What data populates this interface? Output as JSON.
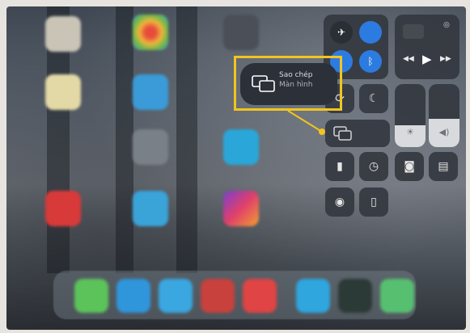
{
  "callout": {
    "title": "Sao chép",
    "subtitle": "Màn hình",
    "frame_color": "#f2c51e",
    "dot_color": "#f2c51e"
  },
  "mirror_tile": {
    "label": ""
  },
  "control_center": {
    "connectivity": [
      "airplane-icon",
      "cellular-icon",
      "wifi-icon",
      "bluetooth-icon"
    ],
    "media": {
      "play_icon": "play-icon",
      "previous_icon": "previous-icon",
      "next_icon": "next-icon",
      "airplay_icon": "airplay-icon"
    },
    "toggles": [
      "orientation-lock-icon",
      "do-not-disturb-moon-icon"
    ],
    "brightness_level": 0.35,
    "volume_level": 0.45,
    "shortcuts": [
      "flashlight-icon",
      "timer-icon",
      "camera-icon",
      "note-icon",
      "record-icon",
      "remote-icon"
    ]
  },
  "colors": {
    "accent_blue": "#2c7be0",
    "tile": "#343840",
    "slider_fill": "#d8dadd"
  }
}
